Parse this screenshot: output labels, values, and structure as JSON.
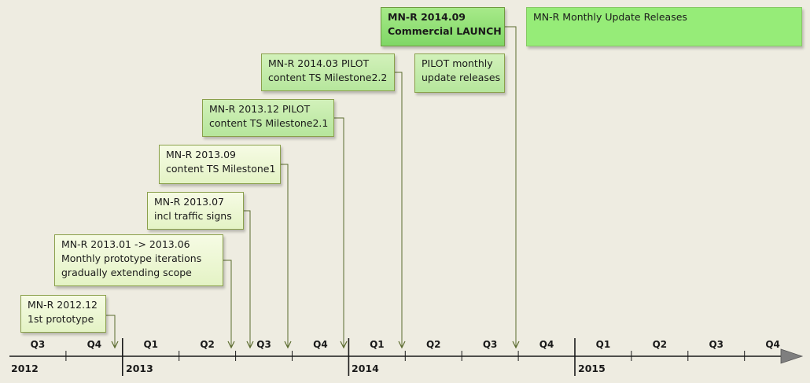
{
  "boxes": [
    {
      "id": "b1",
      "lines": [
        "MN-R 2012.12",
        "1st prototype"
      ]
    },
    {
      "id": "b2",
      "lines": [
        "MN-R 2013.01  -> 2013.06",
        "Monthly prototype iterations",
        "gradually extending scope"
      ]
    },
    {
      "id": "b3",
      "lines": [
        "MN-R 2013.07",
        "incl traffic signs"
      ]
    },
    {
      "id": "b4",
      "lines": [
        "MN-R 2013.09",
        "content TS Milestone1"
      ]
    },
    {
      "id": "b5",
      "lines": [
        "MN-R 2013.12  PILOT",
        "content TS Milestone2.1"
      ]
    },
    {
      "id": "b6",
      "lines": [
        "MN-R 2014.03  PILOT",
        "content TS Milestone2.2"
      ]
    },
    {
      "id": "b7",
      "lines": [
        "PILOT monthly",
        "update releases"
      ]
    },
    {
      "id": "b8",
      "lines": [
        "MN-R 2014.09",
        "Commercial LAUNCH"
      ]
    },
    {
      "id": "b9",
      "lines": [
        "MN-R Monthly Update Releases"
      ]
    }
  ],
  "timeline": {
    "quarters": [
      "Q3",
      "Q4",
      "Q1",
      "Q2",
      "Q3",
      "Q4",
      "Q1",
      "Q2",
      "Q3",
      "Q4",
      "Q1",
      "Q2",
      "Q3",
      "Q4"
    ],
    "years": [
      "2012",
      "2013",
      "2014",
      "2015"
    ]
  },
  "colors": {
    "background": "#eeece1",
    "connector": "#5b6b2e",
    "axis": "#1a1a1a",
    "arrow_head": "#7f7f7f",
    "box_light": "#eaf6d0",
    "box_medium": "#c3ebaa",
    "box_strong": "#8fe077",
    "box_bright": "#96ec78"
  }
}
